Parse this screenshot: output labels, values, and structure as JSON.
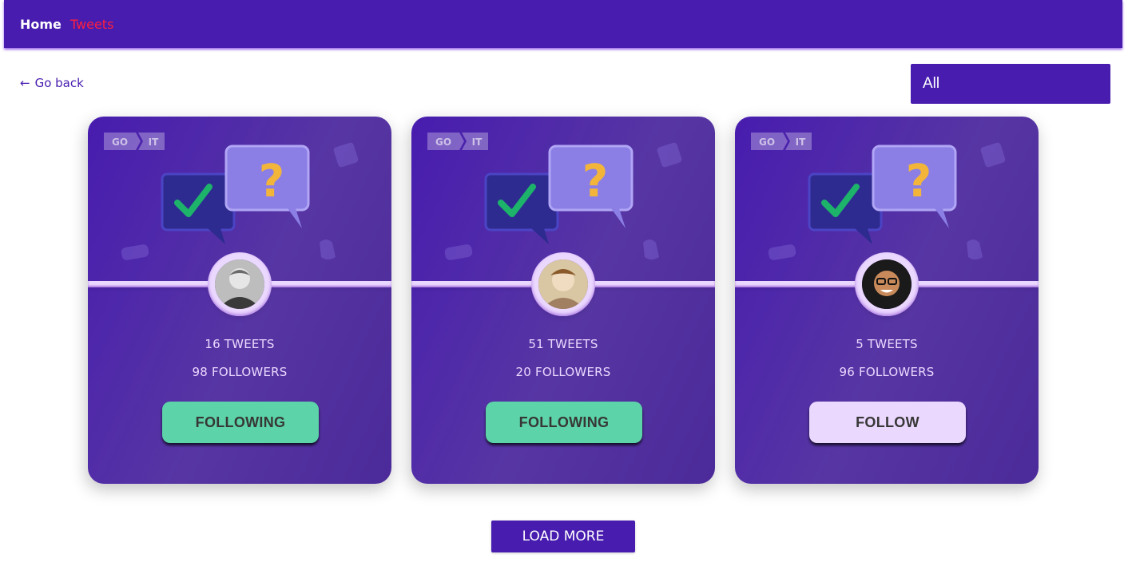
{
  "nav": {
    "home": "Home",
    "tweets": "Tweets",
    "colors": {
      "background": "#471caf",
      "home": "#ffffff",
      "tweets_active": "#ff1f3d"
    }
  },
  "back": {
    "arrow": "←",
    "label": "Go back"
  },
  "filter": {
    "selected": "All"
  },
  "cards": [
    {
      "tweets": "16 TWEETS",
      "followers": "98 FOLLOWERS",
      "button": "FOLLOWING",
      "state": "following"
    },
    {
      "tweets": "51 TWEETS",
      "followers": "20 FOLLOWERS",
      "button": "FOLLOWING",
      "state": "following"
    },
    {
      "tweets": "5 TWEETS",
      "followers": "96 FOLLOWERS",
      "button": "FOLLOW",
      "state": "follow"
    }
  ],
  "card_logo": {
    "left": "GO",
    "right": "IT"
  },
  "load_more": "LOAD MORE",
  "colors": {
    "accent": "#471caf",
    "card_text": "#ebd8ff",
    "following_button": "#5cd3a8",
    "follow_button": "#ebd8ff"
  }
}
